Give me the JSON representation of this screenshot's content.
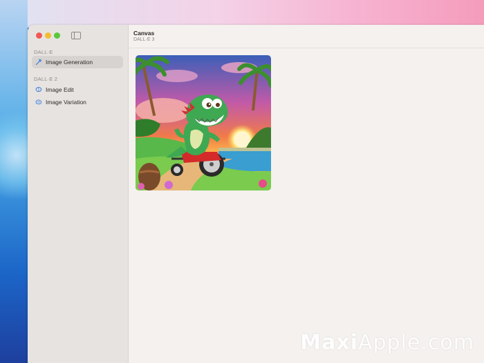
{
  "sidebar": {
    "sections": [
      {
        "label": "DALL·E",
        "items": [
          {
            "label": "Image Generation",
            "icon": "wand-icon",
            "selected": true
          }
        ]
      },
      {
        "label": "DALL·E 2",
        "items": [
          {
            "label": "Image Edit",
            "icon": "brain-icon",
            "selected": false
          },
          {
            "label": "Image Variation",
            "icon": "variation-icon",
            "selected": false
          }
        ]
      }
    ]
  },
  "header": {
    "title": "Canvas",
    "subtitle": "DALL·E 3"
  },
  "watermark": {
    "bold": "Maxi",
    "rest": "Apple.com"
  },
  "colors": {
    "accent": "#3b7ddd",
    "sidebar_bg": "#e6e3e1",
    "content_bg": "#f4f1ee"
  }
}
